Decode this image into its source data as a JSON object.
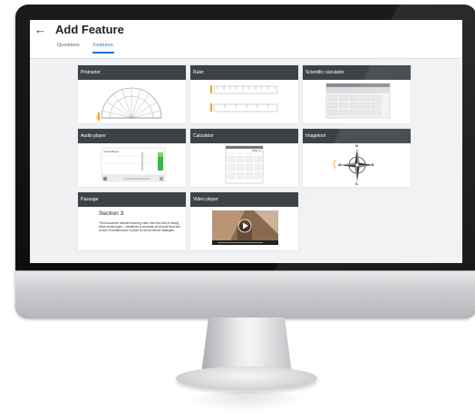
{
  "header": {
    "back_icon": "arrow-left-icon",
    "title": "Add Feature"
  },
  "tabs": [
    {
      "label": "Questions",
      "active": false
    },
    {
      "label": "Features",
      "active": true
    }
  ],
  "features": [
    {
      "name": "Protractor",
      "preview": "protractor"
    },
    {
      "name": "Ruler",
      "preview": "ruler"
    },
    {
      "name": "Scientific calculator",
      "preview": "scientific-calculator"
    },
    {
      "name": "Audio player",
      "preview": "audio-player"
    },
    {
      "name": "Calculator",
      "preview": "calculator"
    },
    {
      "name": "Imagetool",
      "preview": "compass-rose"
    },
    {
      "name": "Passage",
      "preview": "passage"
    },
    {
      "name": "Video player",
      "preview": "video-player"
    }
  ],
  "audio": {
    "label": "Audio Player"
  },
  "calculator": {
    "display": "1001+1"
  },
  "compass": {
    "n": "N",
    "s": "S",
    "e": "E",
    "w": "W"
  },
  "passage": {
    "title": "Section 3",
    "text": "The buzzwords 'blended learning' stem from the idea of mixing these media types – oftentimes a necessity at schools level due to lack of infrastructure in place to roll out device strategies"
  },
  "colors": {
    "accent": "#1f7ad1",
    "card_header": "#3e4248",
    "highlight": "#f5a623",
    "green": "#3cb44a"
  }
}
